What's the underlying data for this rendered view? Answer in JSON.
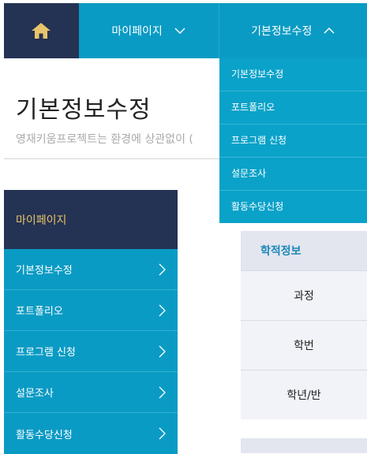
{
  "nav": {
    "home_icon": "home-icon",
    "mypage_label": "마이페이지",
    "active_label": "기본정보수정",
    "home_icon_color": "#e8c46a"
  },
  "dropdown": {
    "items": [
      "기본정보수정",
      "포트폴리오",
      "프로그램 신청",
      "설문조사",
      "활동수당신청"
    ]
  },
  "page": {
    "title": "기본정보수정",
    "subtitle": "영재키움프로젝트는 환경에 상관없이 ("
  },
  "sidebar": {
    "header": "마이페이지",
    "items": [
      "기본정보수정",
      "포트폴리오",
      "프로그램 신청",
      "설문조사",
      "활동수당신청"
    ]
  },
  "info": {
    "header": "학적정보",
    "rows": [
      "과정",
      "학번",
      "학년/반"
    ]
  }
}
